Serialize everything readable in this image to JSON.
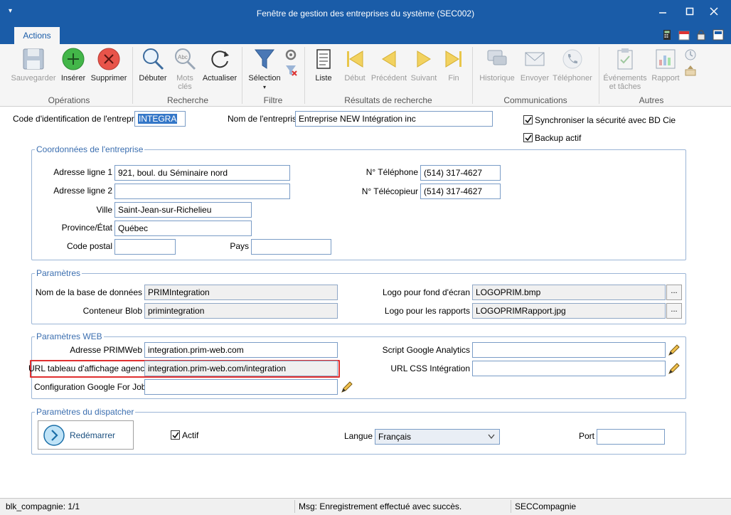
{
  "window": {
    "title": "Fenêtre de gestion des entreprises du système (SEC002)"
  },
  "ribbon": {
    "tab": "Actions",
    "groups": {
      "operations": "Opérations",
      "recherche": "Recherche",
      "filtre": "Filtre",
      "resultats": "Résultats de recherche",
      "communications": "Communications",
      "autres": "Autres"
    },
    "buttons": {
      "sauvegarder": "Sauvegarder",
      "inserer": "Insérer",
      "supprimer": "Supprimer",
      "debuter": "Débuter",
      "mots_cles_1": "Mots",
      "mots_cles_2": "clés",
      "actualiser": "Actualiser",
      "selection": "Sélection",
      "liste": "Liste",
      "debut": "Début",
      "precedent": "Précédent",
      "suivant": "Suivant",
      "fin": "Fin",
      "historique": "Historique",
      "envoyer": "Envoyer",
      "telephoner": "Téléphoner",
      "evenements_1": "Événements",
      "evenements_2": "et tâches",
      "rapport": "Rapport"
    }
  },
  "form": {
    "code_label": "Code d'identification de l'entreprise",
    "code_value": "INTEGRA",
    "nom_label": "Nom de l'entreprise",
    "nom_value": "Entreprise NEW Intégration inc",
    "sync_label": "Synchroniser la sécurité avec BD Cie",
    "backup_label": "Backup actif",
    "coordonnees": {
      "legend": "Coordonnées de l'entreprise",
      "adresse1_label": "Adresse ligne 1",
      "adresse1_value": "921, boul. du Séminaire nord",
      "adresse2_label": "Adresse ligne 2",
      "adresse2_value": "",
      "ville_label": "Ville",
      "ville_value": "Saint-Jean-sur-Richelieu",
      "province_label": "Province/État",
      "province_value": "Québec",
      "code_postal_label": "Code postal",
      "code_postal_value": "",
      "pays_label": "Pays",
      "pays_value": "",
      "telephone_label": "N° Téléphone",
      "telephone_value": "(514) 317-4627",
      "telecopieur_label": "N° Télécopieur",
      "telecopieur_value": "(514) 317-4627"
    },
    "parametres": {
      "legend": "Paramètres",
      "bd_label": "Nom de la base de données",
      "bd_value": "PRIMIntegration",
      "blob_label": "Conteneur Blob",
      "blob_value": "primintegration",
      "logo_fond_label": "Logo pour fond d'écran",
      "logo_fond_value": "LOGOPRIM.bmp",
      "logo_rapports_label": "Logo pour les rapports",
      "logo_rapports_value": "LOGOPRIMRapport.jpg",
      "browse": "..."
    },
    "web": {
      "legend": "Paramètres WEB",
      "adresse_label": "Adresse PRIMWeb",
      "adresse_value": "integration.prim-web.com",
      "url_tableau_label": "URL tableau d'affichage agence",
      "url_tableau_value": "integration.prim-web.com/integration",
      "google_jobs_label": "Configuration Google For Jobs",
      "google_jobs_value": "",
      "analytics_label": "Script Google Analytics",
      "analytics_value": "",
      "css_label": "URL CSS Intégration",
      "css_value": ""
    },
    "dispatcher": {
      "legend": "Paramètres du dispatcher",
      "redemarrer": "Redémarrer",
      "actif_label": "Actif",
      "langue_label": "Langue",
      "langue_value": "Français",
      "port_label": "Port",
      "port_value": ""
    }
  },
  "status": {
    "block": "blk_compagnie: 1/1",
    "msg": "Msg: Enregistrement effectué avec succès.",
    "table": "SECCompagnie"
  },
  "colors": {
    "titlebar": "#1a5ca8",
    "highlight": "#e03030",
    "legend_text": "#3c6fb0"
  }
}
